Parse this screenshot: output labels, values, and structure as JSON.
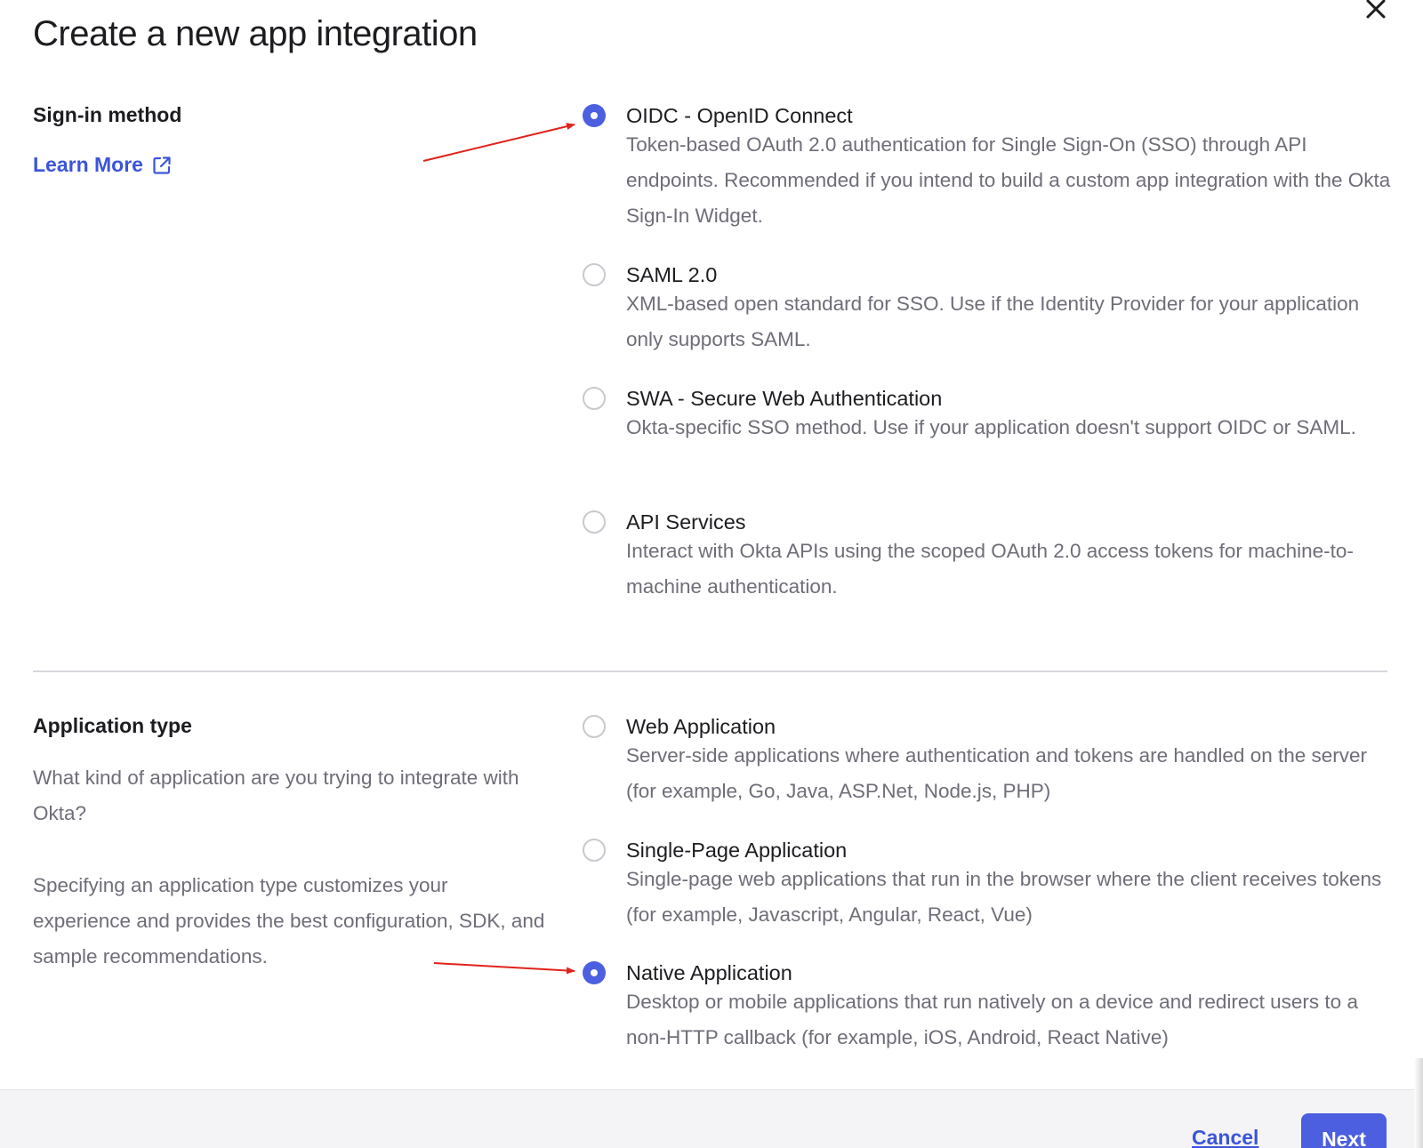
{
  "dialog": {
    "title": "Create a new app integration",
    "close_icon": "close-icon"
  },
  "sign_in": {
    "heading": "Sign-in method",
    "learn_more": "Learn More",
    "learn_more_icon": "external-link-icon",
    "options": [
      {
        "label": "OIDC - OpenID Connect",
        "desc": "Token-based OAuth 2.0 authentication for Single Sign-On (SSO) through API endpoints. Recommended if you intend to build a custom app integration with the Okta Sign-In Widget.",
        "selected": true
      },
      {
        "label": "SAML 2.0",
        "desc": "XML-based open standard for SSO. Use if the Identity Provider for your application only supports SAML.",
        "selected": false
      },
      {
        "label": "SWA - Secure Web Authentication",
        "desc": "Okta-specific SSO method. Use if your application doesn't support OIDC or SAML.",
        "selected": false
      },
      {
        "label": "API Services",
        "desc": "Interact with Okta APIs using the scoped OAuth 2.0 access tokens for machine-to-machine authentication.",
        "selected": false
      }
    ]
  },
  "app_type": {
    "heading": "Application type",
    "question": "What kind of application are you trying to integrate with Okta?",
    "explanation": "Specifying an application type customizes your experience and provides the best configuration, SDK, and sample recommendations.",
    "options": [
      {
        "label": "Web Application",
        "desc": "Server-side applications where authentication and tokens are handled on the server (for example, Go, Java, ASP.Net, Node.js, PHP)",
        "selected": false
      },
      {
        "label": "Single-Page Application",
        "desc": "Single-page web applications that run in the browser where the client receives tokens (for example, Javascript, Angular, React, Vue)",
        "selected": false
      },
      {
        "label": "Native Application",
        "desc": "Desktop or mobile applications that run natively on a device and redirect users to a non-HTTP callback (for example, iOS, Android, React Native)",
        "selected": true
      }
    ]
  },
  "footer": {
    "cancel_label": "Cancel",
    "next_label": "Next"
  },
  "colors": {
    "accent": "#4b5fe0",
    "link": "#3b55d9",
    "annotation_arrow": "#e0231b"
  }
}
